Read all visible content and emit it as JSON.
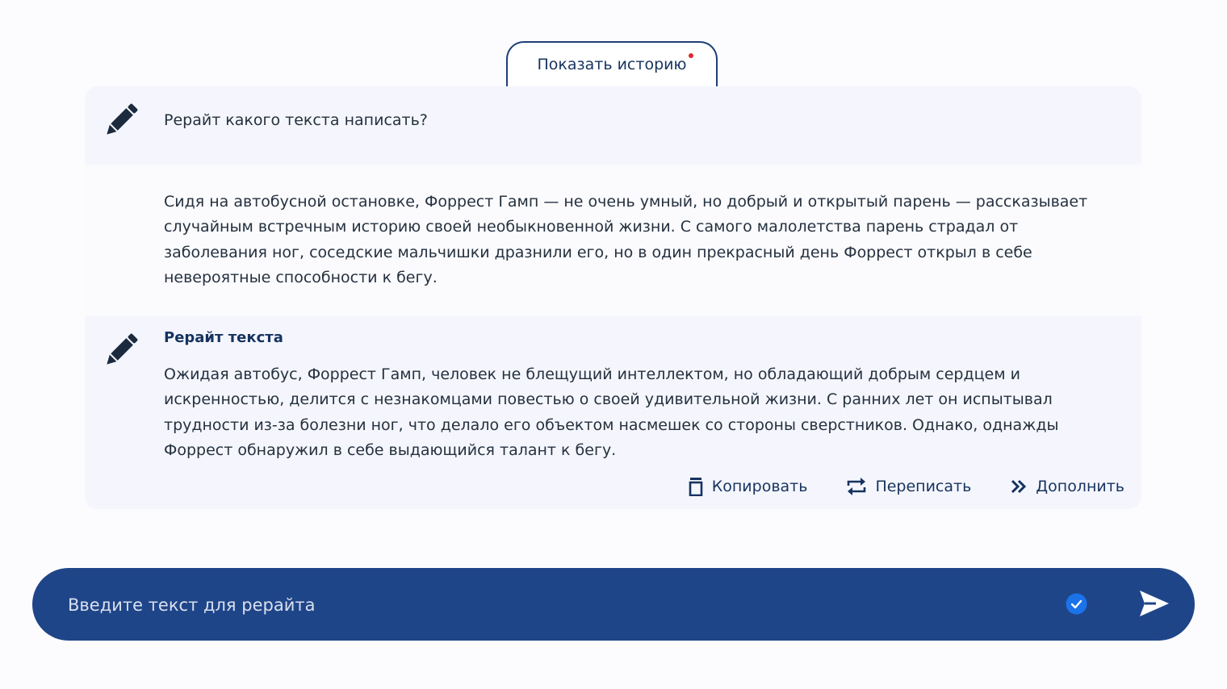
{
  "history_button": {
    "label": "Показать историю"
  },
  "chat": {
    "prompt": {
      "text": "Рерайт какого текста написать?"
    },
    "source": {
      "text": "Сидя на автобусной остановке, Форрест Гамп — не очень умный, но добрый и открытый парень — рассказывает случайным встречным историю своей необыкновенной жизни. С самого малолетства парень страдал от заболевания ног, соседские мальчишки дразнили его, но в один прекрасный день Форрест открыл в себе невероятные способности к бегу."
    },
    "result": {
      "title": "Рерайт текста",
      "text": "Ожидая автобус, Форрест Гамп, человек не блещущий интеллектом, но обладающий добрым сердцем и искренностью, делится с незнакомцами повестью о своей удивительной жизни. С ранних лет он испытывал трудности из-за болезни ног, что делало его объектом насмешек со стороны сверстников. Однако, однажды Форрест обнаружил в себе выдающийся талант к бегу.",
      "actions": {
        "copy": "Копировать",
        "rewrite": "Переписать",
        "extend": "Дополнить"
      }
    }
  },
  "input": {
    "placeholder": "Введите текст для рерайта",
    "value": ""
  },
  "icons": {
    "pencil": "pencil-icon",
    "copy": "copy-icon",
    "rewrite": "repeat-icon",
    "extend": "double-chevron-right-icon",
    "check": "check-circle-icon",
    "send": "send-icon"
  },
  "colors": {
    "primary": "#1f4589",
    "accent_blue": "#1a73e8",
    "notification_dot": "#e12828",
    "panel_bg": "#f5f6fd",
    "text_dark_blue": "#16335f"
  }
}
